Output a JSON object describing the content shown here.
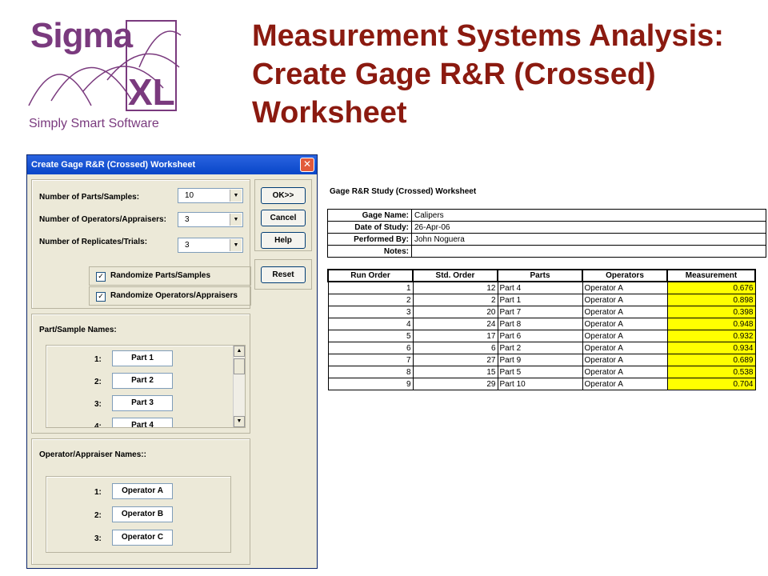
{
  "logo": {
    "line1": "Sigma",
    "line2": "XL",
    "tagline": "Simply Smart Software"
  },
  "slide_title": "Measurement Systems Analysis: Create Gage R&R (Crossed) Worksheet",
  "dialog": {
    "title": "Create Gage R&R (Crossed) Worksheet",
    "close_label": "✕",
    "fields": [
      {
        "label": "Number of Parts/Samples:",
        "value": "10"
      },
      {
        "label": "Number of Operators/Appraisers:",
        "value": "3"
      },
      {
        "label": "Number of Replicates/Trials:",
        "value": "3"
      }
    ],
    "checkboxes": [
      {
        "label": "Randomize Parts/Samples",
        "checked": true,
        "mark": "✓"
      },
      {
        "label": "Randomize Operators/Appraisers",
        "checked": true,
        "mark": "✓"
      }
    ],
    "buttons": {
      "ok": "OK>>",
      "cancel": "Cancel",
      "help": "Help",
      "reset": "Reset"
    },
    "part_names": {
      "heading": "Part/Sample Names:",
      "items": [
        {
          "num": "1:",
          "value": "Part 1"
        },
        {
          "num": "2:",
          "value": "Part 2"
        },
        {
          "num": "3:",
          "value": "Part 3"
        },
        {
          "num": "4:",
          "value": "Part 4"
        }
      ]
    },
    "operator_names": {
      "heading": "Operator/Appraiser Names::",
      "items": [
        {
          "num": "1:",
          "value": "Operator A"
        },
        {
          "num": "2:",
          "value": "Operator B"
        },
        {
          "num": "3:",
          "value": "Operator C"
        }
      ]
    }
  },
  "worksheet": {
    "title": "Gage R&R Study (Crossed) Worksheet",
    "info": [
      {
        "key": "Gage Name:",
        "value": "Calipers"
      },
      {
        "key": "Date of Study:",
        "value": "26-Apr-06"
      },
      {
        "key": "Performed By:",
        "value": "John Noguera"
      },
      {
        "key": "Notes:",
        "value": ""
      }
    ],
    "columns": [
      "Run Order",
      "Std. Order",
      "Parts",
      "Operators",
      "Measurement"
    ],
    "rows": [
      [
        "1",
        "12",
        "Part 4",
        "Operator A",
        "0.676"
      ],
      [
        "2",
        "2",
        "Part 1",
        "Operator A",
        "0.898"
      ],
      [
        "3",
        "20",
        "Part 7",
        "Operator A",
        "0.398"
      ],
      [
        "4",
        "24",
        "Part 8",
        "Operator A",
        "0.948"
      ],
      [
        "5",
        "17",
        "Part 6",
        "Operator A",
        "0.932"
      ],
      [
        "6",
        "6",
        "Part 2",
        "Operator A",
        "0.934"
      ],
      [
        "7",
        "27",
        "Part 9",
        "Operator A",
        "0.689"
      ],
      [
        "8",
        "15",
        "Part 5",
        "Operator A",
        "0.538"
      ],
      [
        "9",
        "29",
        "Part 10",
        "Operator A",
        "0.704"
      ]
    ],
    "highlight_color": "#ffff00"
  }
}
